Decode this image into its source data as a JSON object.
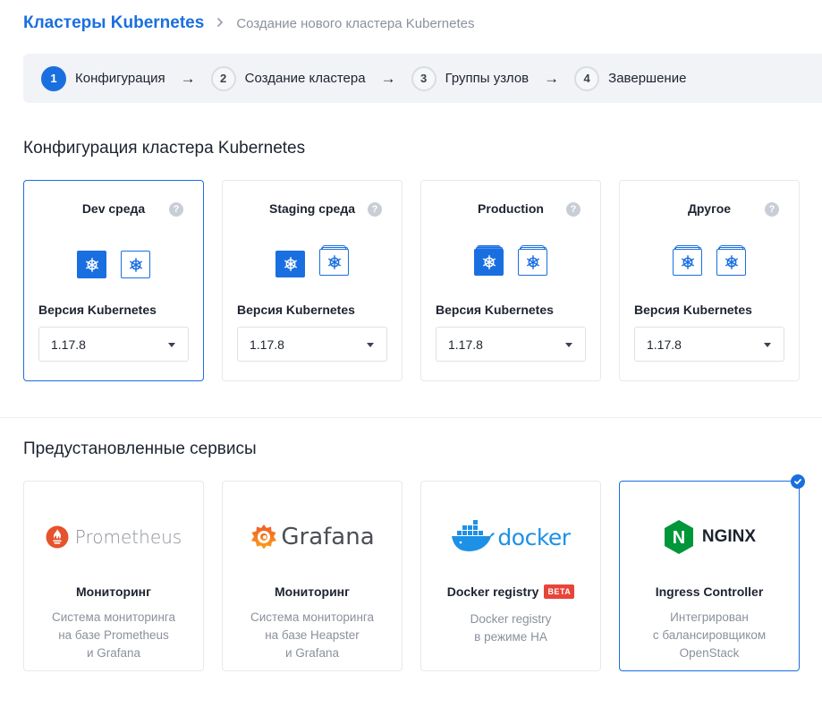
{
  "breadcrumb": {
    "root": "Кластеры Kubernetes",
    "separator": ">",
    "current": "Создание нового кластера Kubernetes"
  },
  "steps": [
    {
      "num": "1",
      "label": "Конфигурация",
      "active": true
    },
    {
      "num": "2",
      "label": "Создание кластера",
      "active": false
    },
    {
      "num": "3",
      "label": "Группы узлов",
      "active": false
    },
    {
      "num": "4",
      "label": "Завершение",
      "active": false
    }
  ],
  "step_arrow": "→",
  "config": {
    "title": "Конфигурация кластера Kubernetes",
    "version_label": "Версия Kubernetes",
    "help_symbol": "?",
    "cards": [
      {
        "title": "Dev среда",
        "version": "1.17.8",
        "selected": true
      },
      {
        "title": "Staging среда",
        "version": "1.17.8",
        "selected": false
      },
      {
        "title": "Production",
        "version": "1.17.8",
        "selected": false
      },
      {
        "title": "Другое",
        "version": "1.17.8",
        "selected": false
      }
    ]
  },
  "services": {
    "title": "Предустановленные сервисы",
    "cards": [
      {
        "logo_text": "Prometheus",
        "title": "Мониторинг",
        "desc1": "Система мониторинга",
        "desc2": "на базе Prometheus",
        "desc3": "и Grafana",
        "selected": false
      },
      {
        "logo_text": "Grafana",
        "title": "Мониторинг",
        "desc1": "Система мониторинга",
        "desc2": "на базе Heapster",
        "desc3": "и Grafana",
        "selected": false
      },
      {
        "logo_text": "docker",
        "title": "Docker registry",
        "badge": "BETA",
        "desc1": "Docker registry",
        "desc2": "в режиме HA",
        "desc3": "",
        "selected": false
      },
      {
        "logo_text": "NGINX",
        "logo_mark": "N",
        "title": "Ingress Controller",
        "desc1": "Интегрирован",
        "desc2": "с балансировщиком",
        "desc3": "OpenStack",
        "selected": true
      }
    ]
  },
  "colors": {
    "accent": "#1a6fe0",
    "prometheus": "#e6522c",
    "grafana": "#f46800",
    "docker": "#1d91e6",
    "nginx": "#009639",
    "beta": "#e8443a"
  },
  "icons": {
    "kubernetes": "kubernetes-wheel-icon",
    "help": "question-icon",
    "check": "check-icon",
    "caret": "chevron-down-icon",
    "arrow": "arrow-right-icon"
  }
}
